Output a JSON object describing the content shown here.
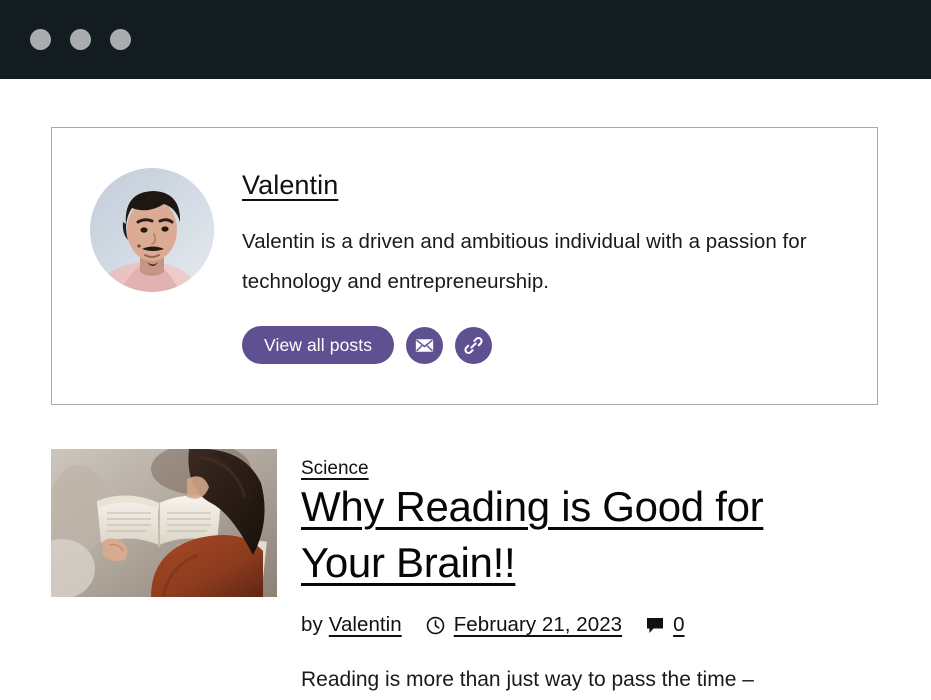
{
  "browser": {
    "dots": [
      "window-dot-1",
      "window-dot-2",
      "window-dot-3"
    ],
    "bar_color": "#131c21",
    "dot_color": "#a9adb0"
  },
  "theme": {
    "accent_purple": "#5f5092",
    "card_border": "#a9a9a9",
    "text_color": "#111111"
  },
  "author_card": {
    "avatar_alt": "Valentin portrait photo",
    "name": "Valentin",
    "bio": "Valentin is a driven and ambitious individual with a passion for technology and entrepreneurship.",
    "view_all_posts_label": "View all posts",
    "email_icon": "envelope-icon",
    "link_icon": "chain-link-icon"
  },
  "post": {
    "thumbnail_alt": "Woman reading an open book",
    "category": "Science",
    "title": "Why Reading is Good for Your Brain!!",
    "by_label": "by",
    "author": "Valentin",
    "date_icon": "clock-icon",
    "date": "February 21, 2023",
    "comment_icon": "comment-bubble-icon",
    "comment_count": "0",
    "excerpt": "Reading is more than just way to pass the time –"
  }
}
